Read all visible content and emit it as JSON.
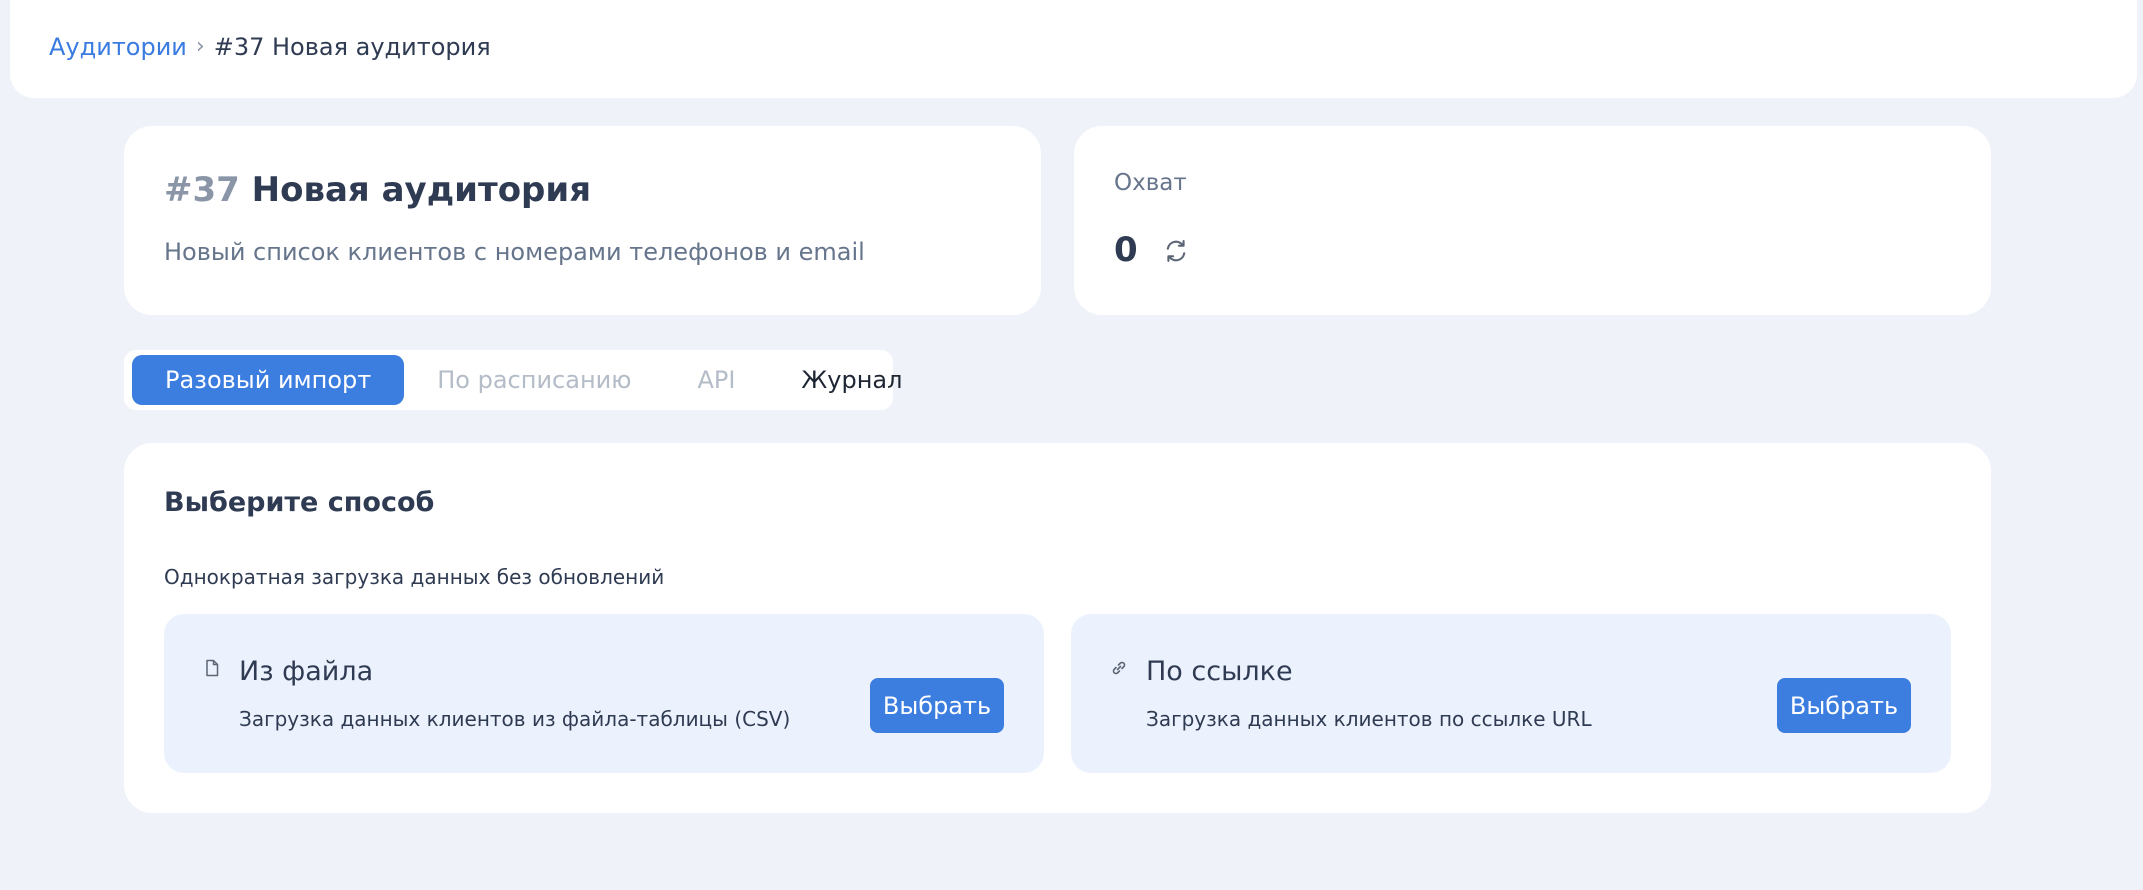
{
  "breadcrumb": {
    "parent": "Аудитории",
    "separator": "›",
    "current": "#37 Новая аудитория"
  },
  "audience": {
    "number": "#37",
    "name": "Новая аудитория",
    "description": "Новый список клиентов с номерами телефонов и email"
  },
  "reach": {
    "label": "Охват",
    "value": "0",
    "refresh_icon": "refresh-icon"
  },
  "tabs": [
    {
      "label": "Разовый импорт",
      "state": "active"
    },
    {
      "label": "По расписанию",
      "state": "disabled"
    },
    {
      "label": "API",
      "state": "disabled"
    },
    {
      "label": "Журнал",
      "state": "normal"
    }
  ],
  "method": {
    "title": "Выберите способ",
    "description": "Однократная загрузка данных без обновлений",
    "options": [
      {
        "icon": "file-icon",
        "title": "Из файла",
        "description": "Загрузка данных клиентов из файла-таблицы (CSV)",
        "button": "Выбрать"
      },
      {
        "icon": "link-icon",
        "title": "По ссылке",
        "description": "Загрузка данных клиентов по ссылке URL",
        "button": "Выбрать"
      }
    ]
  },
  "colors": {
    "accent": "#3c7de0",
    "link": "#3a7be0",
    "background": "#eff3f9",
    "option_background": "#ecf2fd"
  }
}
